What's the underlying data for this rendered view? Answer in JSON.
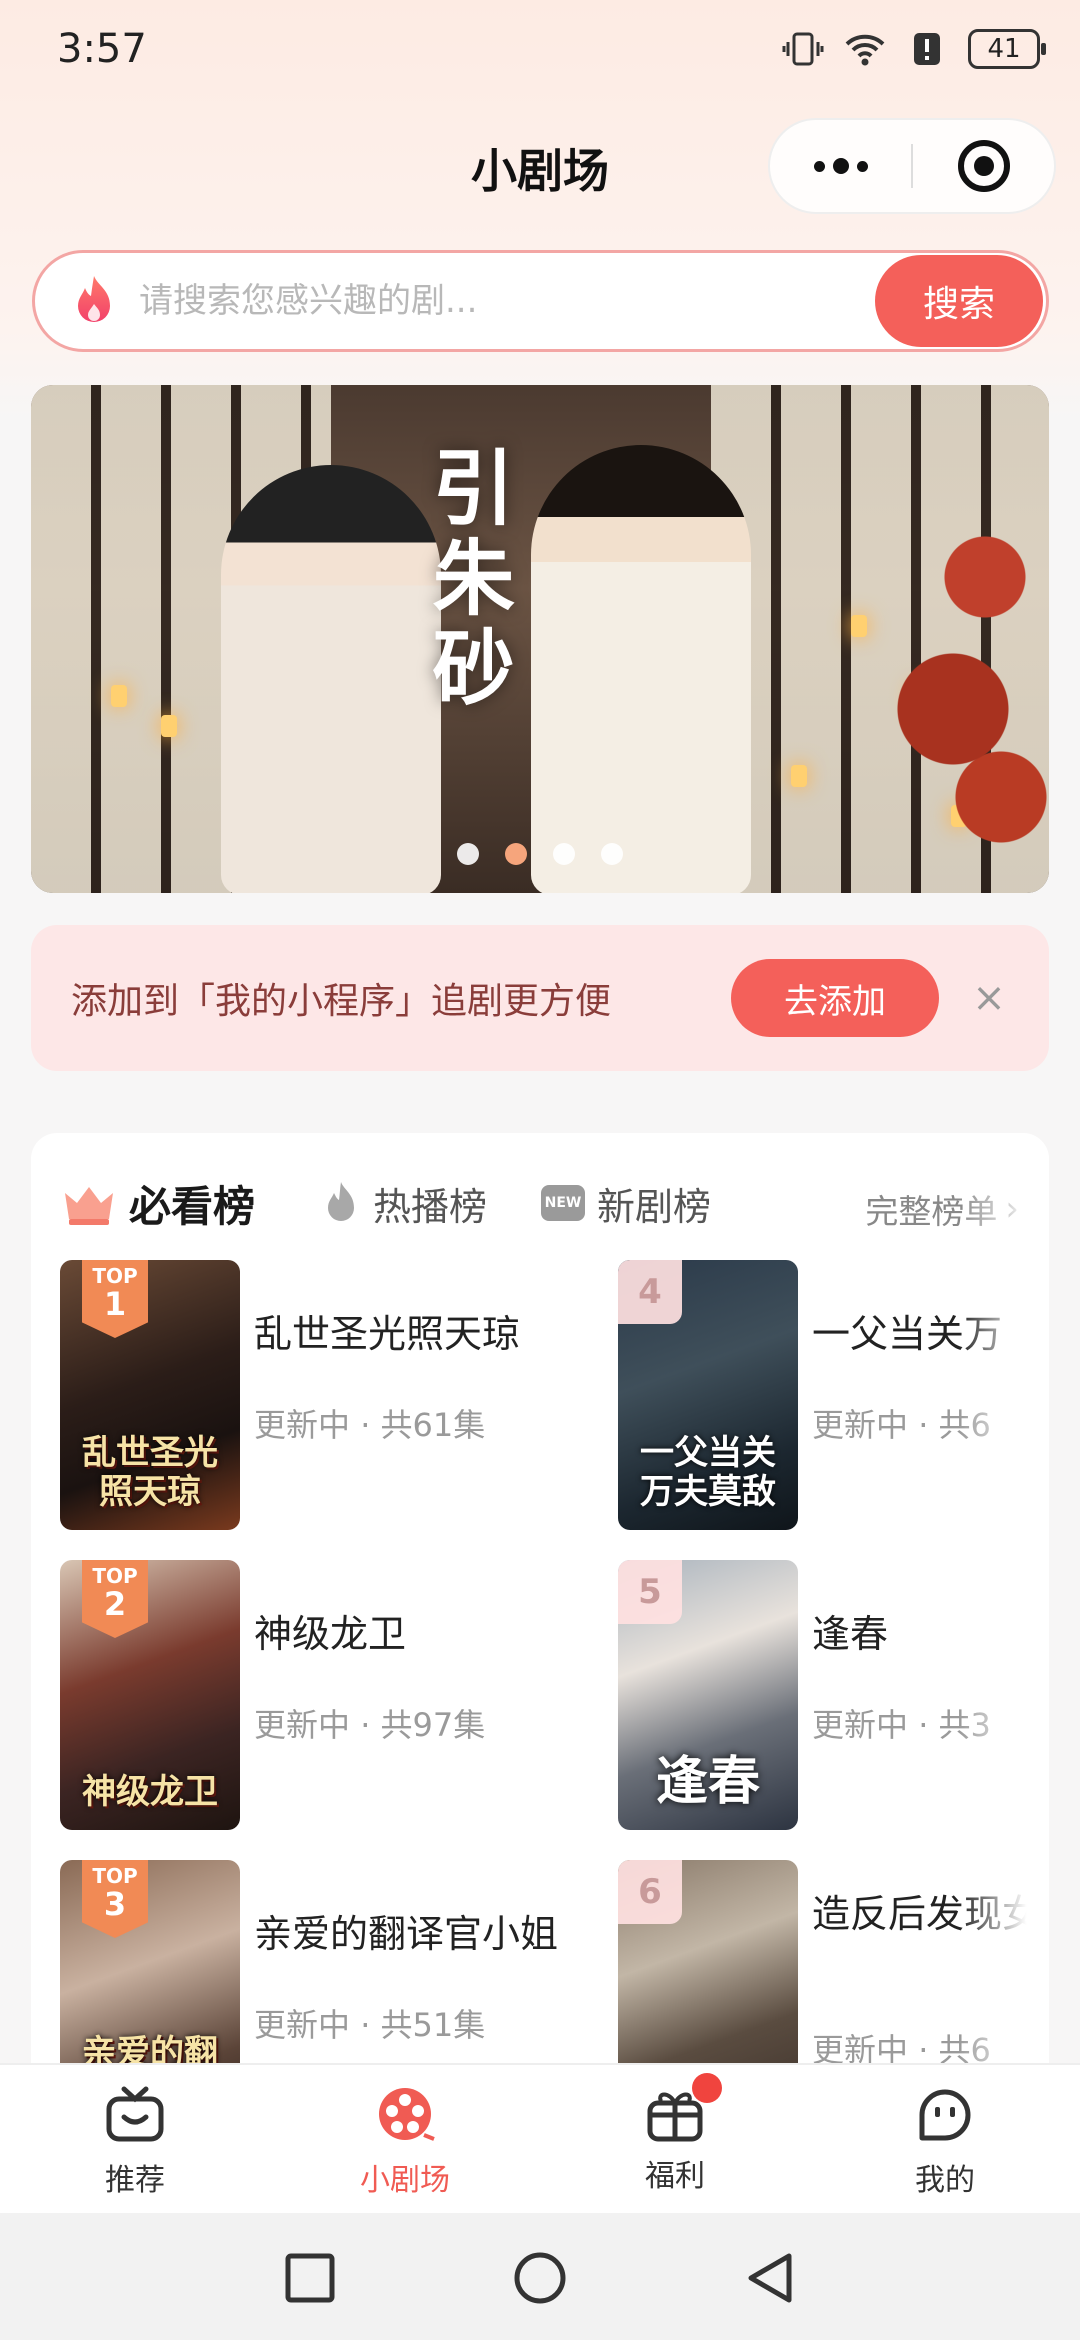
{
  "status_bar": {
    "time": "3:57",
    "battery": "41"
  },
  "nav": {
    "title": "小剧场"
  },
  "search": {
    "placeholder": "请搜索您感兴趣的剧...",
    "button": "搜索"
  },
  "banner": {
    "title": "引朱砂",
    "dot_count": 4,
    "active_dot": 2
  },
  "add_tip": {
    "text": "添加到「我的小程序」追剧更方便",
    "button": "去添加",
    "close": "×"
  },
  "rank": {
    "tabs": [
      {
        "label": "必看榜",
        "active": true
      },
      {
        "label": "热播榜",
        "active": false
      },
      {
        "label": "新剧榜",
        "active": false
      }
    ],
    "full_list": "完整榜单",
    "new_badge": "NEW",
    "top_label": "TOP",
    "items": [
      {
        "rank": "1",
        "name": "乱世圣光照天琼",
        "status": "更新中",
        "episodes": "共61集",
        "cover_text": "乱世圣光照天琼"
      },
      {
        "rank": "4",
        "name": "一父当关万",
        "status": "更新中",
        "episodes": "共6",
        "cover_text": "一父当关万夫莫敌"
      },
      {
        "rank": "2",
        "name": "神级龙卫",
        "status": "更新中",
        "episodes": "共97集",
        "cover_text": "神级龙卫"
      },
      {
        "rank": "5",
        "name": "逢春",
        "status": "更新中",
        "episodes": "共3",
        "cover_text": "逢春"
      },
      {
        "rank": "3",
        "name": "亲爱的翻译官小姐",
        "status": "更新中",
        "episodes": "共51集",
        "cover_text": "亲爱的翻译官小姐"
      },
      {
        "rank": "6",
        "name": "造反后发现女帝",
        "status": "更新中",
        "episodes": "共6",
        "cover_text": ""
      }
    ]
  },
  "tabbar": {
    "items": [
      {
        "label": "推荐",
        "active": false
      },
      {
        "label": "小剧场",
        "active": true
      },
      {
        "label": "福利",
        "active": false
      },
      {
        "label": "我的",
        "active": false
      }
    ]
  },
  "colors": {
    "accent": "#f4605a",
    "tip_bg": "#fde7e7",
    "badge": "#f18a55"
  }
}
